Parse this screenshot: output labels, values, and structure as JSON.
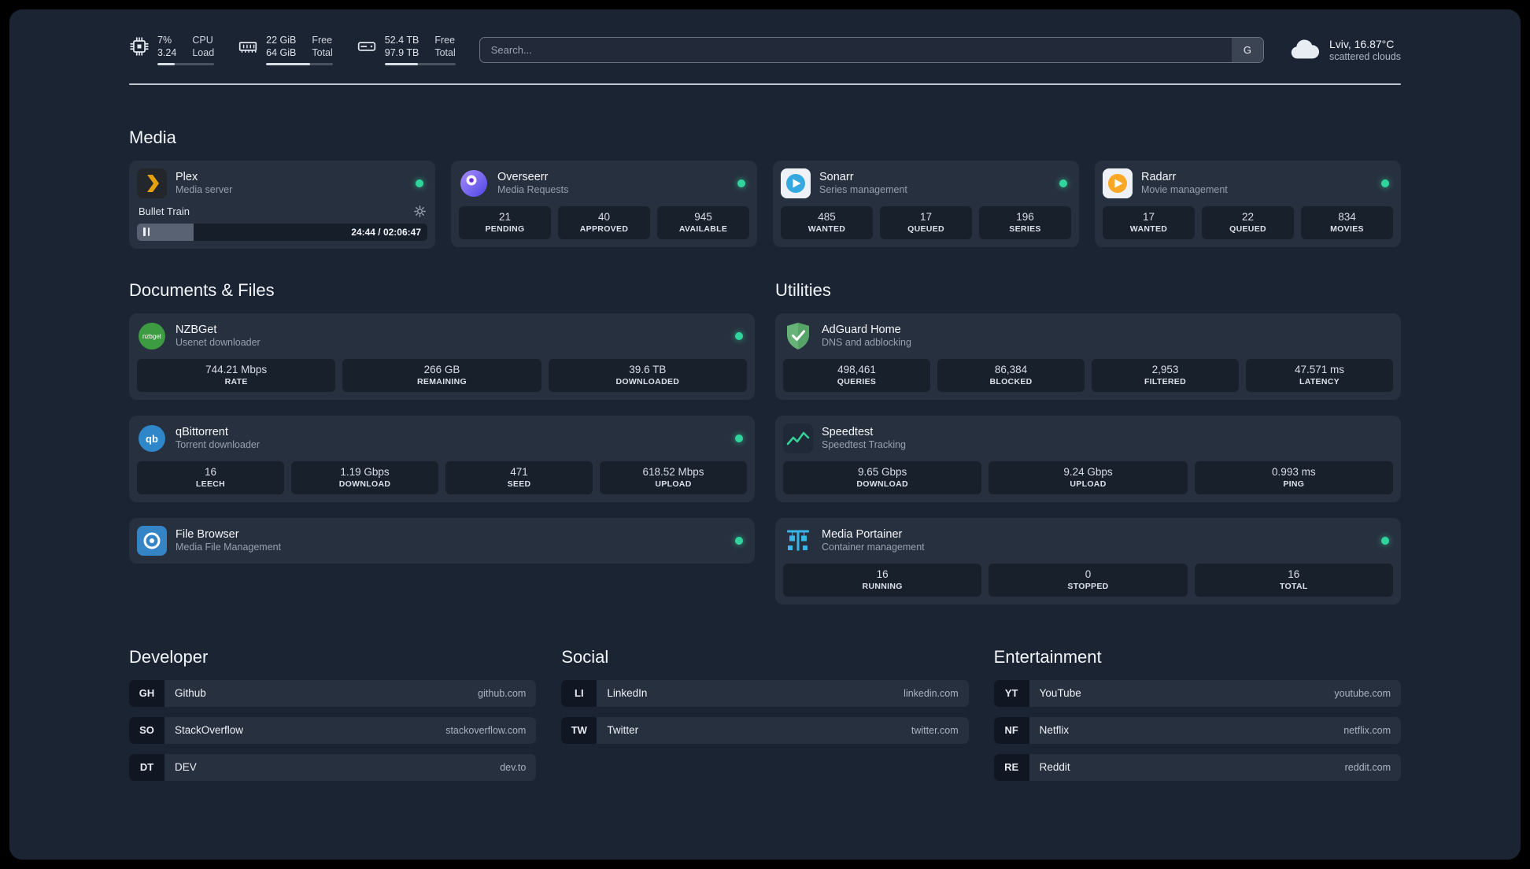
{
  "theme": {
    "page_background": "#1b2433",
    "card_background": "#27303f",
    "status_online": "#31d49c"
  },
  "topbar": {
    "resources": [
      {
        "icon": "cpu-icon",
        "value_top": "7%",
        "value_bottom": "3.24",
        "label_top": "CPU",
        "label_bottom": "Load",
        "progress_style": "width:30%"
      },
      {
        "icon": "memory-icon",
        "value_top": "22 GiB",
        "value_bottom": "64 GiB",
        "label_top": "Free",
        "label_bottom": "Total",
        "progress_style": "width:66%"
      },
      {
        "icon": "disk-icon",
        "value_top": "52.4 TB",
        "value_bottom": "97.9 TB",
        "label_top": "Free",
        "label_bottom": "Total",
        "progress_style": "width:47%"
      }
    ],
    "search": {
      "placeholder": "Search...",
      "provider_button": "G"
    },
    "weather": {
      "location": "Lviv, 16.87°C",
      "condition": "scattered clouds"
    }
  },
  "groups": {
    "media": {
      "title": "Media",
      "services": [
        {
          "name": "Plex",
          "description": "Media server",
          "icon": "plex-icon",
          "status": "online",
          "player": {
            "track": "Bullet Train",
            "time": "24:44 / 02:06:47",
            "progress_style": "width:19.6%"
          }
        },
        {
          "name": "Overseerr",
          "description": "Media Requests",
          "icon": "overseerr-icon",
          "status": "online",
          "stats": [
            {
              "value": "21",
              "label": "PENDING"
            },
            {
              "value": "40",
              "label": "APPROVED"
            },
            {
              "value": "945",
              "label": "AVAILABLE"
            }
          ]
        },
        {
          "name": "Sonarr",
          "description": "Series management",
          "icon": "sonarr-icon",
          "status": "online",
          "stats": [
            {
              "value": "485",
              "label": "WANTED"
            },
            {
              "value": "17",
              "label": "QUEUED"
            },
            {
              "value": "196",
              "label": "SERIES"
            }
          ]
        },
        {
          "name": "Radarr",
          "description": "Movie management",
          "icon": "radarr-icon",
          "status": "online",
          "stats": [
            {
              "value": "17",
              "label": "WANTED"
            },
            {
              "value": "22",
              "label": "QUEUED"
            },
            {
              "value": "834",
              "label": "MOVIES"
            }
          ]
        }
      ]
    },
    "documents": {
      "title": "Documents & Files",
      "services": [
        {
          "name": "NZBGet",
          "description": "Usenet downloader",
          "icon": "nzbget-icon",
          "status": "online",
          "stats": [
            {
              "value": "744.21 Mbps",
              "label": "RATE"
            },
            {
              "value": "266 GB",
              "label": "REMAINING"
            },
            {
              "value": "39.6 TB",
              "label": "DOWNLOADED"
            }
          ]
        },
        {
          "name": "qBittorrent",
          "description": "Torrent downloader",
          "icon": "qbittorrent-icon",
          "status": "online",
          "stats": [
            {
              "value": "16",
              "label": "LEECH"
            },
            {
              "value": "1.19 Gbps",
              "label": "DOWNLOAD"
            },
            {
              "value": "471",
              "label": "SEED"
            },
            {
              "value": "618.52 Mbps",
              "label": "UPLOAD"
            }
          ]
        },
        {
          "name": "File Browser",
          "description": "Media File Management",
          "icon": "filebrowser-icon",
          "status": "online",
          "stats": []
        }
      ]
    },
    "utilities": {
      "title": "Utilities",
      "services": [
        {
          "name": "AdGuard Home",
          "description": "DNS and adblocking",
          "icon": "adguard-icon",
          "status": "none",
          "stats": [
            {
              "value": "498,461",
              "label": "QUERIES"
            },
            {
              "value": "86,384",
              "label": "BLOCKED"
            },
            {
              "value": "2,953",
              "label": "FILTERED"
            },
            {
              "value": "47.571 ms",
              "label": "LATENCY"
            }
          ]
        },
        {
          "name": "Speedtest",
          "description": "Speedtest Tracking",
          "icon": "speedtest-icon",
          "status": "none",
          "stats": [
            {
              "value": "9.65 Gbps",
              "label": "DOWNLOAD"
            },
            {
              "value": "9.24 Gbps",
              "label": "UPLOAD"
            },
            {
              "value": "0.993 ms",
              "label": "PING"
            }
          ]
        },
        {
          "name": "Media Portainer",
          "description": "Container management",
          "icon": "portainer-icon",
          "status": "online",
          "stats": [
            {
              "value": "16",
              "label": "RUNNING"
            },
            {
              "value": "0",
              "label": "STOPPED"
            },
            {
              "value": "16",
              "label": "TOTAL"
            }
          ]
        }
      ]
    }
  },
  "bookmarks": [
    {
      "title": "Developer",
      "items": [
        {
          "abbr": "GH",
          "name": "Github",
          "url": "github.com"
        },
        {
          "abbr": "SO",
          "name": "StackOverflow",
          "url": "stackoverflow.com"
        },
        {
          "abbr": "DT",
          "name": "DEV",
          "url": "dev.to"
        }
      ]
    },
    {
      "title": "Social",
      "items": [
        {
          "abbr": "LI",
          "name": "LinkedIn",
          "url": "linkedin.com"
        },
        {
          "abbr": "TW",
          "name": "Twitter",
          "url": "twitter.com"
        }
      ]
    },
    {
      "title": "Entertainment",
      "items": [
        {
          "abbr": "YT",
          "name": "YouTube",
          "url": "youtube.com"
        },
        {
          "abbr": "NF",
          "name": "Netflix",
          "url": "netflix.com"
        },
        {
          "abbr": "RE",
          "name": "Reddit",
          "url": "reddit.com"
        }
      ]
    }
  ]
}
